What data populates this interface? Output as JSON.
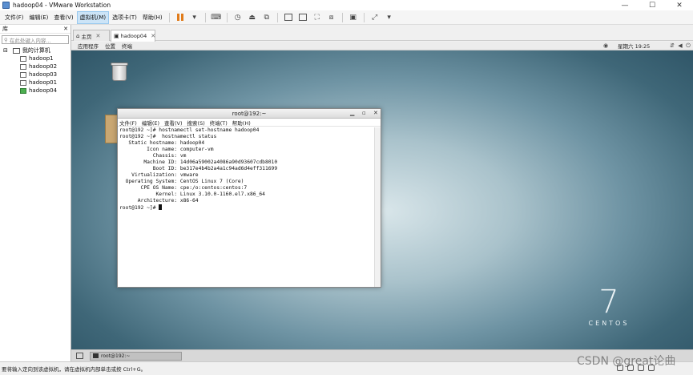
{
  "window": {
    "title": "hadoop04 - VMware Workstation",
    "minimize": "—",
    "maximize": "☐",
    "close": "✕"
  },
  "menubar": [
    "文件(F)",
    "编辑(E)",
    "查看(V)",
    "虚拟机(M)",
    "选项卡(T)",
    "帮助(H)"
  ],
  "library": {
    "header": "库",
    "close": "✕",
    "search_placeholder": "在此处键入内容...",
    "root": "我的计算机",
    "vms": [
      "hadoop1",
      "hadoop02",
      "hadoop03",
      "hadoop01",
      "hadoop04"
    ]
  },
  "tabs": {
    "home": "主页",
    "vm": "hadoop04",
    "close": "✕"
  },
  "gnome_bar": {
    "applications": "应用程序",
    "places": "位置",
    "terminal": "终端",
    "clock": "星期六 19:25"
  },
  "terminal": {
    "title": "root@192:~",
    "menu": [
      "文件(F)",
      "编辑(E)",
      "查看(V)",
      "搜索(S)",
      "终端(T)",
      "帮助(H)"
    ],
    "lines": [
      "root@192 ~]# hostnamectl set-hostname hadoop04",
      "root@192 ~]#  hostnamectl status",
      "   Static hostname: hadoop04",
      "         Icon name: computer-vm",
      "           Chassis: vm",
      "        Machine ID: 14d06a59002a4086a90d93607cdb8010",
      "           Boot ID: be317e4b4b2a4a1c94ad6d4eff311699",
      "    Virtualization: vmware",
      "  Operating System: CentOS Linux 7 (Core)",
      "       CPE OS Name: cpe:/o:centos:centos:7",
      "            Kernel: Linux 3.10.0-1160.el7.x86_64",
      "      Architecture: x86-64"
    ],
    "prompt": "root@192 ~]# "
  },
  "centos": {
    "number": "7",
    "word": "CENTOS"
  },
  "taskbar": {
    "task": "root@192:~"
  },
  "statusbar": {
    "text": "要将输入定向到该虚拟机，请在虚拟机内部单击或按 Ctrl+G。"
  },
  "watermark": "CSDN @great论曲"
}
